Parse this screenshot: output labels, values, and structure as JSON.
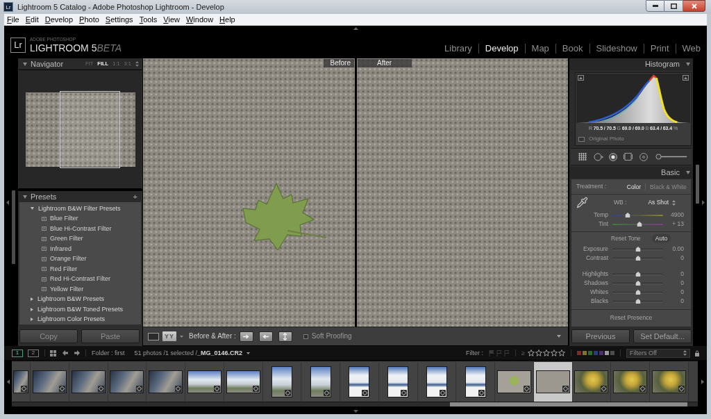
{
  "window": {
    "icon": "Lr",
    "title": "Lightroom 5 Catalog - Adobe Photoshop Lightroom - Develop"
  },
  "menu": [
    "File",
    "Edit",
    "Develop",
    "Photo",
    "Settings",
    "Tools",
    "View",
    "Window",
    "Help"
  ],
  "identity_plate": {
    "logo": "Lr",
    "vendor": "ADOBE PHOTOSHOP",
    "product": "LIGHTROOM 5",
    "edition": "BETA"
  },
  "modules": [
    {
      "label": "Library",
      "selected": false
    },
    {
      "label": "Develop",
      "selected": true
    },
    {
      "label": "Map",
      "selected": false
    },
    {
      "label": "Book",
      "selected": false
    },
    {
      "label": "Slideshow",
      "selected": false
    },
    {
      "label": "Print",
      "selected": false
    },
    {
      "label": "Web",
      "selected": false
    }
  ],
  "navigator": {
    "title": "Navigator",
    "zoom_options": [
      {
        "label": "FIT",
        "selected": false
      },
      {
        "label": "FILL",
        "selected": true
      },
      {
        "label": "1:1",
        "selected": false
      },
      {
        "label": "3:1",
        "selected": false
      }
    ]
  },
  "presets": {
    "title": "Presets",
    "add": "+",
    "folders": [
      {
        "label": "Lightroom B&W Filter Presets",
        "expanded": true,
        "children": [
          {
            "label": "Blue Filter"
          },
          {
            "label": "Blue Hi-Contrast Filter"
          },
          {
            "label": "Green Filter"
          },
          {
            "label": "Infrared"
          },
          {
            "label": "Orange Filter"
          },
          {
            "label": "Red Filter"
          },
          {
            "label": "Red Hi-Contrast Filter"
          },
          {
            "label": "Yellow Filter"
          }
        ]
      },
      {
        "label": "Lightroom B&W Presets",
        "expanded": false
      },
      {
        "label": "Lightroom B&W Toned Presets",
        "expanded": false
      },
      {
        "label": "Lightroom Color Presets",
        "expanded": false
      }
    ]
  },
  "left_buttons": [
    "Copy",
    "Paste"
  ],
  "compare": {
    "before": "Before",
    "after": "After"
  },
  "toolbar": {
    "view_button": "YY",
    "label": "Before & After :",
    "soft_proofing": {
      "label": "Soft Proofing",
      "checked": false
    }
  },
  "histogram": {
    "title": "Histogram",
    "readout": "R **70.5 / 70.5** G **69.0 / 69.0** B **63.4 / 63.4** %",
    "original_photo": {
      "label": "Original Photo",
      "checked": false
    }
  },
  "basic": {
    "title": "Basic",
    "treatment_label": "Treatment :",
    "treatments": [
      {
        "label": "Color",
        "selected": true
      },
      {
        "label": "Black & White",
        "selected": false
      }
    ],
    "wb_label": "WB :",
    "wb_value": "As Shot",
    "wb_sliders": [
      {
        "kind": "temperature",
        "label": "Temp",
        "level": 0.3,
        "reading": "4900"
      },
      {
        "kind": "tint",
        "label": "Tint",
        "level": 0.53,
        "reading": "+ 13"
      }
    ],
    "reset_tone": "Reset Tone",
    "auto": "Auto",
    "tone_groups": [
      [
        {
          "label": "Exposure",
          "level": 0.5,
          "reading": "0.00"
        },
        {
          "label": "Contrast",
          "level": 0.5,
          "reading": "0"
        }
      ],
      [
        {
          "label": "Highlights",
          "level": 0.5,
          "reading": "0"
        },
        {
          "label": "Shadows",
          "level": 0.5,
          "reading": "0"
        },
        {
          "label": "Whites",
          "level": 0.5,
          "reading": "0"
        },
        {
          "label": "Blacks",
          "level": 0.5,
          "reading": "0"
        }
      ]
    ],
    "reset_presence": "Reset Presence"
  },
  "right_buttons": [
    "Previous",
    "Set Default..."
  ],
  "filmstrip": {
    "displays": [
      {
        "label": "1",
        "selected": true
      },
      {
        "label": "2",
        "selected": false
      }
    ],
    "source": "Folder : first",
    "status": "51 photos /1 selected /**_MG_0146.CR2**",
    "filter_label": "Filter :",
    "rating_operator": "≥",
    "stars": 0,
    "color_labels": [
      {
        "color": "#7a2c2c"
      },
      {
        "color": "#7a742c"
      },
      {
        "color": "#2c6a30"
      },
      {
        "color": "#2c3a7a"
      },
      {
        "color": "#4e2c6e"
      },
      {
        "color": "#9a9a9a"
      },
      {
        "color": "#4c4c4c"
      }
    ],
    "filter_preset": "Filters Off",
    "thumbnails": [
      {
        "kind": "partial",
        "selected": false
      },
      {
        "kind": "people",
        "selected": false
      },
      {
        "kind": "people",
        "selected": false
      },
      {
        "kind": "people",
        "selected": false
      },
      {
        "kind": "people",
        "selected": false
      },
      {
        "kind": "building",
        "selected": false
      },
      {
        "kind": "building",
        "selected": false
      },
      {
        "kind": "tower",
        "selected": false
      },
      {
        "kind": "tower",
        "selected": false
      },
      {
        "kind": "facade",
        "selected": false
      },
      {
        "kind": "facade",
        "selected": false
      },
      {
        "kind": "facade",
        "selected": false
      },
      {
        "kind": "facade",
        "selected": false
      },
      {
        "kind": "leaf",
        "selected": false
      },
      {
        "kind": "gravel",
        "selected": true
      },
      {
        "kind": "flowers",
        "selected": false
      },
      {
        "kind": "flowers",
        "selected": false
      },
      {
        "kind": "flowers",
        "selected": false
      }
    ]
  }
}
